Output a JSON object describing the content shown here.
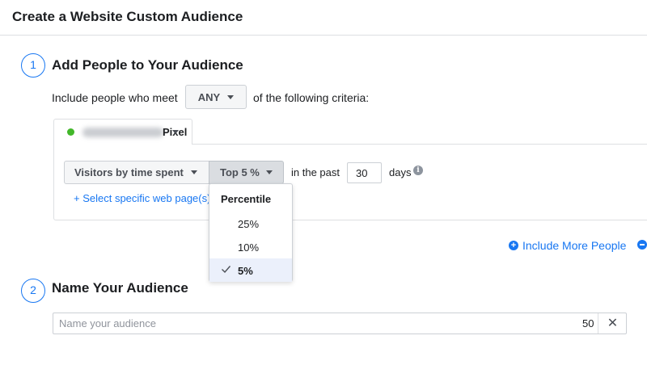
{
  "header": {
    "title": "Create a Website Custom Audience"
  },
  "step1": {
    "number": "1",
    "title": "Add People to Your Audience",
    "include_prefix": "Include people who meet",
    "match_value": "ANY",
    "include_suffix": "of the following criteria:",
    "pixel_label": "Pixel",
    "pixel_status_color": "#42b72a",
    "rule": {
      "event_value": "Visitors by time spent",
      "percentile_value": "Top 5 %",
      "past_prefix": "in the past",
      "days_value": "30",
      "days_suffix": "days",
      "info_icon": "i"
    },
    "select_pages_link": "+ Select specific web page(s)",
    "percentile_menu": {
      "header": "Percentile",
      "options": [
        {
          "label": "25%",
          "selected": false
        },
        {
          "label": "10%",
          "selected": false
        },
        {
          "label": "5%",
          "selected": true
        }
      ]
    },
    "include_more_label": "Include More People"
  },
  "step2": {
    "number": "2",
    "title": "Name Your Audience",
    "name_placeholder": "Name your audience",
    "name_value": "",
    "char_count": "50",
    "clear_icon": "✕"
  },
  "colors": {
    "accent": "#1877f2",
    "selected_bg": "#ebf0fb"
  }
}
